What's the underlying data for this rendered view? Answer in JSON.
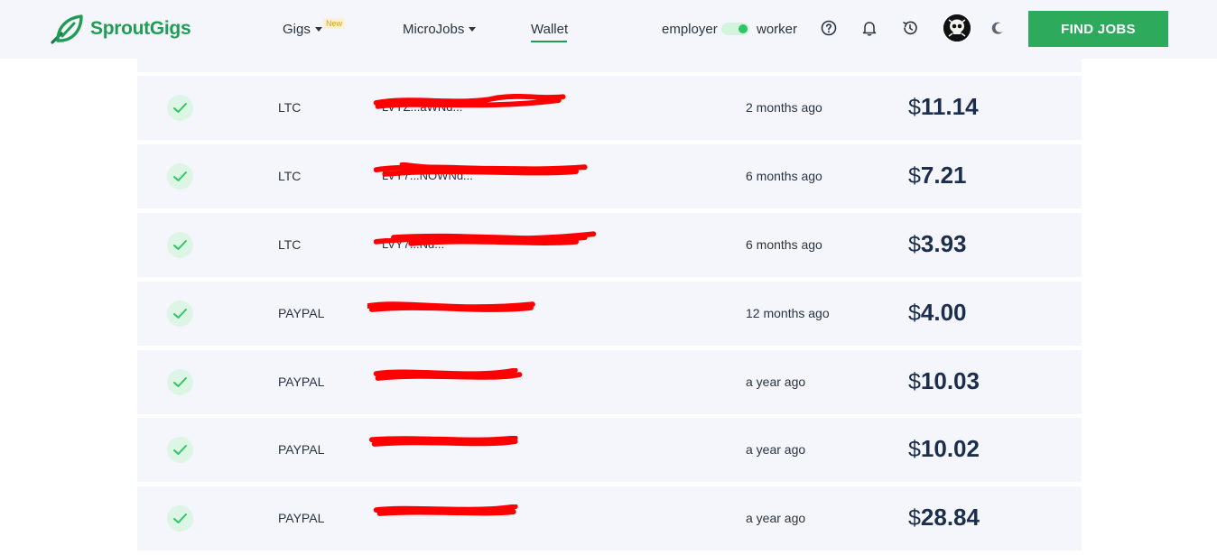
{
  "header": {
    "logo_text": "SproutGigs",
    "nav": {
      "gigs": "Gigs",
      "gigs_badge": "New",
      "microjobs": "MicroJobs",
      "wallet": "Wallet"
    },
    "mode_left": "employer",
    "mode_right": "worker",
    "find_jobs_label": "FIND JOBS",
    "icons": [
      "leaf-logo-icon",
      "help-icon",
      "bell-icon",
      "history-icon",
      "avatar",
      "moon-icon"
    ]
  },
  "transactions": [
    {
      "status": "completed",
      "method": "LTC",
      "address": "LVYZ...aWNd...",
      "time": "2 months ago",
      "currency": "$",
      "amount": "11.14"
    },
    {
      "status": "completed",
      "method": "LTC",
      "address": "LVY7...NOWNd...",
      "time": "6 months ago",
      "currency": "$",
      "amount": "7.21"
    },
    {
      "status": "completed",
      "method": "LTC",
      "address": "LVY7...Nd...",
      "time": "6 months ago",
      "currency": "$",
      "amount": "3.93"
    },
    {
      "status": "completed",
      "method": "PAYPAL",
      "address": "",
      "time": "12 months ago",
      "currency": "$",
      "amount": "4.00"
    },
    {
      "status": "completed",
      "method": "PAYPAL",
      "address": "",
      "time": "a year ago",
      "currency": "$",
      "amount": "10.03"
    },
    {
      "status": "completed",
      "method": "PAYPAL",
      "address": "",
      "time": "a year ago",
      "currency": "$",
      "amount": "10.02"
    },
    {
      "status": "completed",
      "method": "PAYPAL",
      "address": "",
      "time": "a year ago",
      "currency": "$",
      "amount": "28.84"
    }
  ],
  "colors": {
    "brand_green": "#1f9d55",
    "button_green": "#2eaa5c",
    "row_bg": "#f4f6fb",
    "amount_text": "#1b2e4d",
    "redaction": "#ff0000"
  }
}
